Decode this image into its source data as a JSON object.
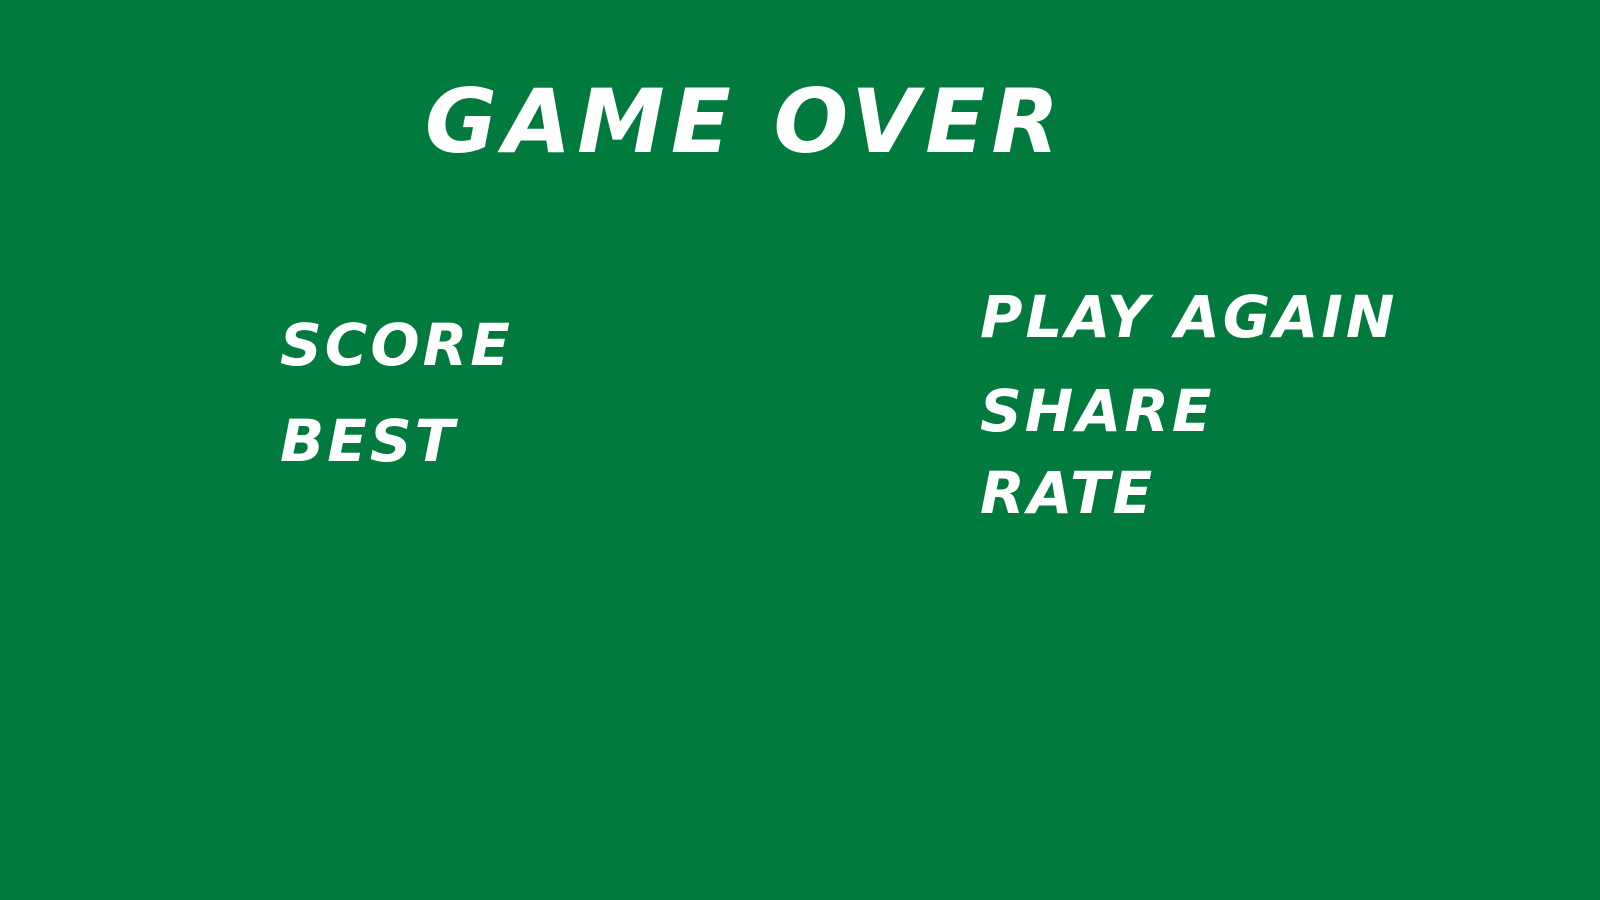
{
  "game_over": {
    "title": "GAME OVER",
    "stats": {
      "score_label": "SCORE",
      "best_label": "BEST"
    },
    "menu": {
      "play_again": "PLAY AGAIN",
      "share": "SHARE",
      "rate": "RATE"
    }
  },
  "colors": {
    "background": "#007a3d",
    "text": "#ffffff"
  }
}
